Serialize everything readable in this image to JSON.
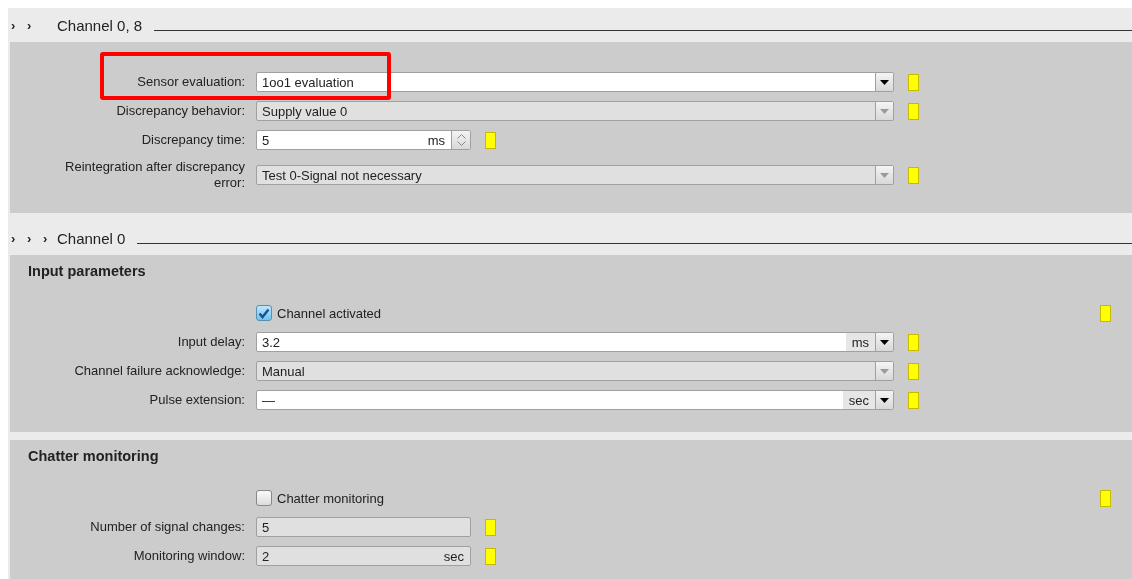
{
  "sections": [
    {
      "prefix": "› ›",
      "title": "Channel 0, 8",
      "groups": [
        {
          "rows": [
            {
              "kind": "dropdown",
              "label": "Sensor evaluation:",
              "value": "1oo1 evaluation",
              "disabled": false,
              "highlighted": true
            },
            {
              "kind": "dropdown",
              "label": "Discrepancy behavior:",
              "value": "Supply value 0",
              "disabled": true,
              "highlighted": false
            },
            {
              "kind": "spin",
              "label": "Discrepancy time:",
              "value": "5",
              "unit": "ms",
              "disabled": false,
              "highlighted": false
            },
            {
              "kind": "dropdown",
              "label": "Reintegration after discrepancy error:",
              "value": "Test 0-Signal not necessary",
              "disabled": true,
              "highlighted": false
            }
          ]
        }
      ]
    },
    {
      "prefix": "› › ›",
      "title": "Channel 0",
      "groups": [
        {
          "heading": "Input parameters",
          "rows": [
            {
              "kind": "checkbox",
              "label": "Channel activated",
              "checked": true,
              "highlighted": false
            },
            {
              "kind": "unit-dropdown",
              "label": "Input delay:",
              "value": "3.2",
              "unit": "ms",
              "disabled": false,
              "highlighted": false
            },
            {
              "kind": "dropdown",
              "label": "Channel failure acknowledge:",
              "value": "Manual",
              "disabled": true,
              "highlighted": false
            },
            {
              "kind": "unit-dropdown",
              "label": "Pulse extension:",
              "value": "—",
              "unit": "sec",
              "disabled": false,
              "highlighted": false
            }
          ]
        },
        {
          "heading": "Chatter monitoring",
          "rows": [
            {
              "kind": "checkbox",
              "label": "Chatter monitoring",
              "checked": false,
              "highlighted": false
            },
            {
              "kind": "text",
              "label": "Number of signal changes:",
              "value": "5",
              "disabled": true,
              "highlighted": false
            },
            {
              "kind": "text",
              "label": "Monitoring window:",
              "value": "2",
              "unit": "sec",
              "disabled": true,
              "highlighted": false
            }
          ]
        }
      ]
    }
  ]
}
